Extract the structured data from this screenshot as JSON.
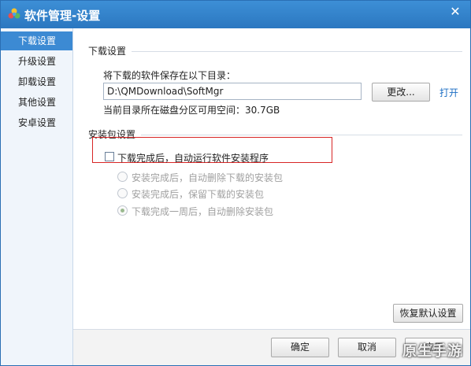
{
  "window": {
    "title": "软件管理-设置",
    "close_glyph": "✕"
  },
  "sidebar": {
    "items": [
      {
        "label": "下载设置",
        "active": true
      },
      {
        "label": "升级设置",
        "active": false
      },
      {
        "label": "卸载设置",
        "active": false
      },
      {
        "label": "其他设置",
        "active": false
      },
      {
        "label": "安卓设置",
        "active": false
      }
    ]
  },
  "download": {
    "section_title": "下载设置",
    "dir_label": "将下载的软件保存在以下目录：",
    "path_value": "D:\\QMDownload\\SoftMgr",
    "change_button": "更改...",
    "open_link": "打开",
    "space_text": "当前目录所在磁盘分区可用空间：30.7GB"
  },
  "install": {
    "section_title": "安装包设置",
    "auto_run_label": "下载完成后，自动运行软件安装程序",
    "auto_run_checked": false,
    "options": [
      {
        "label": "安装完成后，自动删除下载的安装包",
        "checked": false
      },
      {
        "label": "安装完成后，保留下载的安装包",
        "checked": false
      },
      {
        "label": "下载完成一周后，自动删除安装包",
        "checked": true
      }
    ]
  },
  "footer": {
    "restore_button": "恢复默认设置",
    "ok_button": "确定",
    "cancel_button": "取消",
    "apply_button": "应用"
  },
  "watermark": "原生手游",
  "colors": {
    "titlebar": "#2b77c0",
    "active_nav": "#3c8ad3",
    "link": "#1d6fc4",
    "highlight": "#d82626"
  }
}
